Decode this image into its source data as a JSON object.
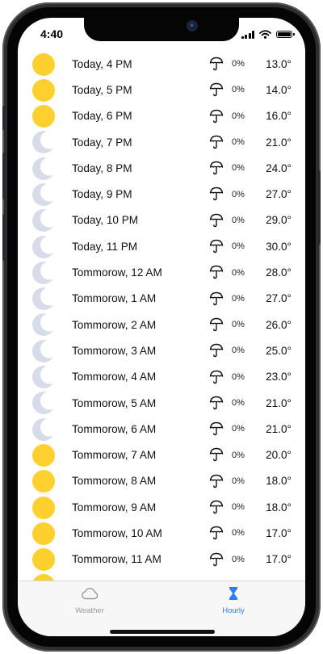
{
  "status_bar": {
    "time": "4:40"
  },
  "hourly": [
    {
      "time": "Today, 4 PM",
      "icon": "sun-icon",
      "rain": "0%",
      "temp": "13.0°"
    },
    {
      "time": "Today, 5 PM",
      "icon": "sun-icon",
      "rain": "0%",
      "temp": "14.0°"
    },
    {
      "time": "Today, 6 PM",
      "icon": "sun-icon",
      "rain": "0%",
      "temp": "16.0°"
    },
    {
      "time": "Today, 7 PM",
      "icon": "moon-icon",
      "rain": "0%",
      "temp": "21.0°"
    },
    {
      "time": "Today, 8 PM",
      "icon": "moon-icon",
      "rain": "0%",
      "temp": "24.0°"
    },
    {
      "time": "Today, 9 PM",
      "icon": "moon-icon",
      "rain": "0%",
      "temp": "27.0°"
    },
    {
      "time": "Today, 10 PM",
      "icon": "moon-icon",
      "rain": "0%",
      "temp": "29.0°"
    },
    {
      "time": "Today, 11 PM",
      "icon": "moon-icon",
      "rain": "0%",
      "temp": "30.0°"
    },
    {
      "time": "Tommorow, 12 AM",
      "icon": "moon-icon",
      "rain": "0%",
      "temp": "28.0°"
    },
    {
      "time": "Tommorow, 1 AM",
      "icon": "moon-icon",
      "rain": "0%",
      "temp": "27.0°"
    },
    {
      "time": "Tommorow, 2 AM",
      "icon": "moon-icon",
      "rain": "0%",
      "temp": "26.0°"
    },
    {
      "time": "Tommorow, 3 AM",
      "icon": "moon-icon",
      "rain": "0%",
      "temp": "25.0°"
    },
    {
      "time": "Tommorow, 4 AM",
      "icon": "moon-icon",
      "rain": "0%",
      "temp": "23.0°"
    },
    {
      "time": "Tommorow, 5 AM",
      "icon": "moon-icon",
      "rain": "0%",
      "temp": "21.0°"
    },
    {
      "time": "Tommorow, 6 AM",
      "icon": "moon-icon",
      "rain": "0%",
      "temp": "21.0°"
    },
    {
      "time": "Tommorow, 7 AM",
      "icon": "sun-icon",
      "rain": "0%",
      "temp": "20.0°"
    },
    {
      "time": "Tommorow, 8 AM",
      "icon": "sun-icon",
      "rain": "0%",
      "temp": "18.0°"
    },
    {
      "time": "Tommorow, 9 AM",
      "icon": "sun-icon",
      "rain": "0%",
      "temp": "18.0°"
    },
    {
      "time": "Tommorow, 10 AM",
      "icon": "sun-icon",
      "rain": "0%",
      "temp": "17.0°"
    },
    {
      "time": "Tommorow, 11 AM",
      "icon": "sun-icon",
      "rain": "0%",
      "temp": "17.0°"
    },
    {
      "time": "",
      "icon": "sun-icon",
      "rain": "",
      "temp": ""
    }
  ],
  "tabbar": {
    "weather_label": "Weather",
    "weather_icon": "cloud-icon",
    "hourly_label": "Hourly",
    "hourly_icon": "hourglass-icon"
  },
  "colors": {
    "sun": "#fed02f",
    "moon": "#d6dde8",
    "accent": "#2f7cf6",
    "inactive": "#999999"
  }
}
